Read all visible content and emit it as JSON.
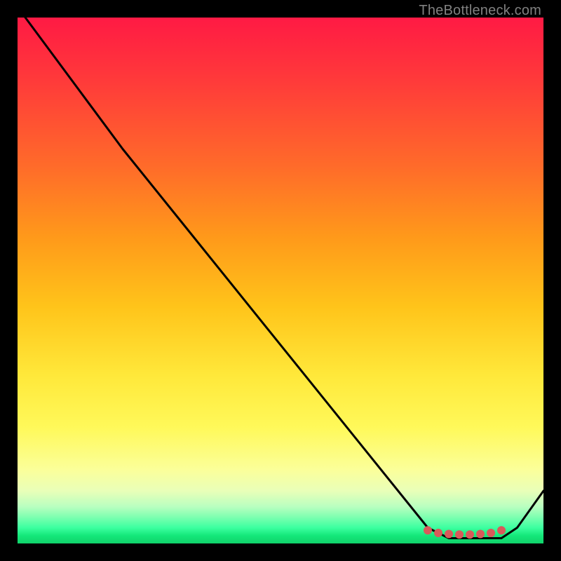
{
  "attribution": "TheBottleneck.com",
  "chart_data": {
    "type": "line",
    "title": "",
    "xlabel": "",
    "ylabel": "",
    "xlim": [
      0,
      100
    ],
    "ylim": [
      0,
      100
    ],
    "series": [
      {
        "name": "curve",
        "x": [
          0,
          20,
          78,
          82,
          92,
          95,
          100
        ],
        "values": [
          102,
          75,
          3,
          1,
          1,
          3,
          10
        ]
      }
    ],
    "markers": {
      "name": "flat-region-markers",
      "x": [
        78,
        80,
        82,
        84,
        86,
        88,
        90,
        92
      ],
      "values": [
        2.5,
        2,
        1.8,
        1.7,
        1.7,
        1.8,
        2,
        2.5
      ],
      "color": "#d85a5a",
      "size": 6
    },
    "background_gradient": {
      "stops": [
        {
          "pos": 0.0,
          "color": "#ff1a44"
        },
        {
          "pos": 0.55,
          "color": "#ffc41a"
        },
        {
          "pos": 0.86,
          "color": "#fbff9a"
        },
        {
          "pos": 1.0,
          "color": "#10d26a"
        }
      ]
    }
  }
}
